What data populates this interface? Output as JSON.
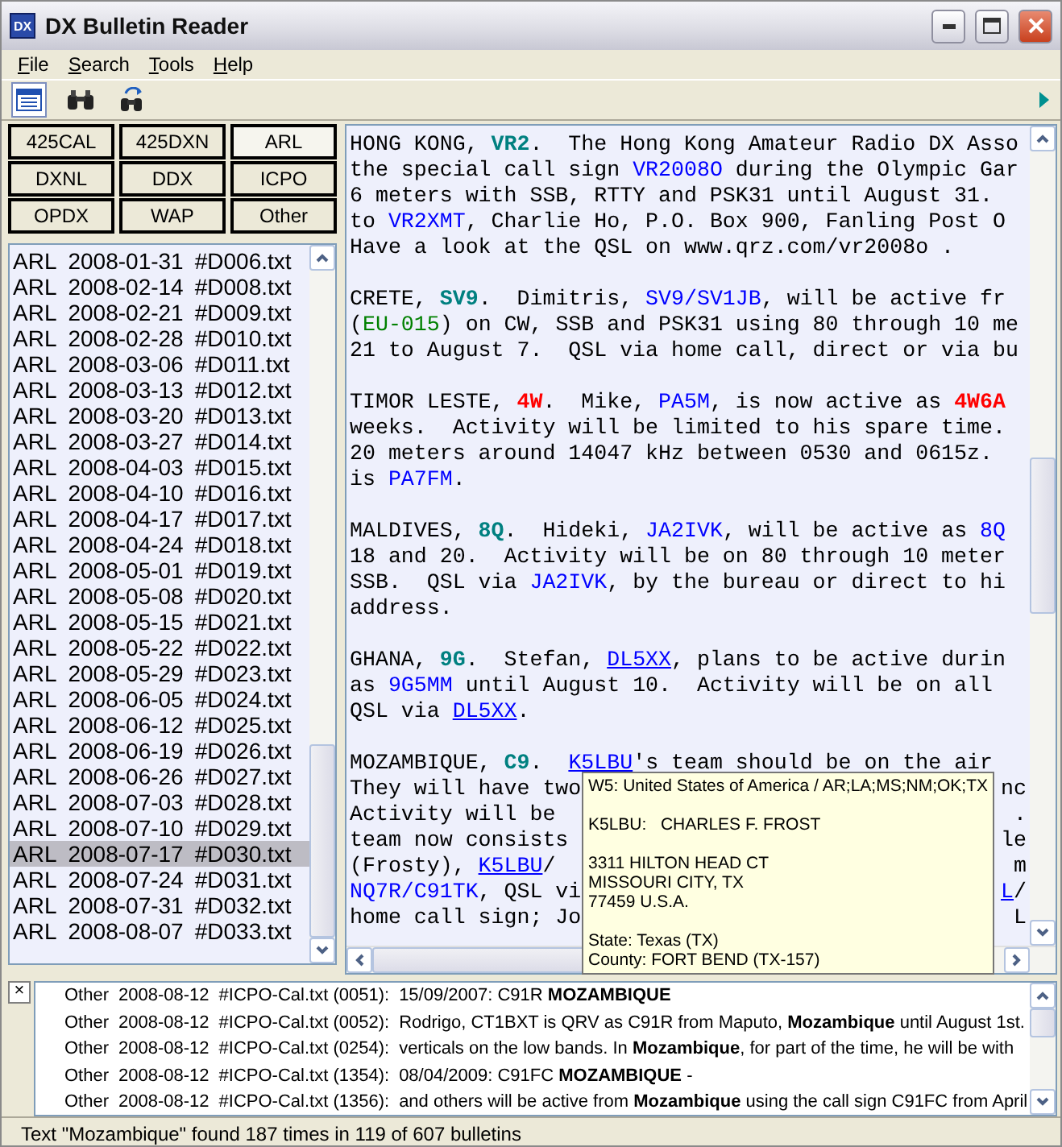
{
  "window": {
    "title": "DX Bulletin Reader",
    "app_icon": "DX"
  },
  "menu": [
    {
      "label": "File"
    },
    {
      "label": "Search"
    },
    {
      "label": "Tools"
    },
    {
      "label": "Help"
    }
  ],
  "toolbar": [
    {
      "kind": "list",
      "selected": true
    },
    {
      "kind": "search",
      "selected": false
    },
    {
      "kind": "search-again",
      "selected": false
    }
  ],
  "sources": [
    {
      "label": "425CAL",
      "selected": false
    },
    {
      "label": "425DXN",
      "selected": false
    },
    {
      "label": "ARL",
      "selected": true
    },
    {
      "label": "DXNL",
      "selected": false
    },
    {
      "label": "DDX",
      "selected": false
    },
    {
      "label": "ICPO",
      "selected": false
    },
    {
      "label": "OPDX",
      "selected": false
    },
    {
      "label": "WAP",
      "selected": false
    },
    {
      "label": "Other",
      "selected": false
    }
  ],
  "bulletins": [
    {
      "source": "ARL",
      "date": "2008-01-31",
      "file": "#D006.txt",
      "selected": false
    },
    {
      "source": "ARL",
      "date": "2008-02-14",
      "file": "#D008.txt",
      "selected": false
    },
    {
      "source": "ARL",
      "date": "2008-02-21",
      "file": "#D009.txt",
      "selected": false
    },
    {
      "source": "ARL",
      "date": "2008-02-28",
      "file": "#D010.txt",
      "selected": false
    },
    {
      "source": "ARL",
      "date": "2008-03-06",
      "file": "#D011.txt",
      "selected": false
    },
    {
      "source": "ARL",
      "date": "2008-03-13",
      "file": "#D012.txt",
      "selected": false
    },
    {
      "source": "ARL",
      "date": "2008-03-20",
      "file": "#D013.txt",
      "selected": false
    },
    {
      "source": "ARL",
      "date": "2008-03-27",
      "file": "#D014.txt",
      "selected": false
    },
    {
      "source": "ARL",
      "date": "2008-04-03",
      "file": "#D015.txt",
      "selected": false
    },
    {
      "source": "ARL",
      "date": "2008-04-10",
      "file": "#D016.txt",
      "selected": false
    },
    {
      "source": "ARL",
      "date": "2008-04-17",
      "file": "#D017.txt",
      "selected": false
    },
    {
      "source": "ARL",
      "date": "2008-04-24",
      "file": "#D018.txt",
      "selected": false
    },
    {
      "source": "ARL",
      "date": "2008-05-01",
      "file": "#D019.txt",
      "selected": false
    },
    {
      "source": "ARL",
      "date": "2008-05-08",
      "file": "#D020.txt",
      "selected": false
    },
    {
      "source": "ARL",
      "date": "2008-05-15",
      "file": "#D021.txt",
      "selected": false
    },
    {
      "source": "ARL",
      "date": "2008-05-22",
      "file": "#D022.txt",
      "selected": false
    },
    {
      "source": "ARL",
      "date": "2008-05-29",
      "file": "#D023.txt",
      "selected": false
    },
    {
      "source": "ARL",
      "date": "2008-06-05",
      "file": "#D024.txt",
      "selected": false
    },
    {
      "source": "ARL",
      "date": "2008-06-12",
      "file": "#D025.txt",
      "selected": false
    },
    {
      "source": "ARL",
      "date": "2008-06-19",
      "file": "#D026.txt",
      "selected": false
    },
    {
      "source": "ARL",
      "date": "2008-06-26",
      "file": "#D027.txt",
      "selected": false
    },
    {
      "source": "ARL",
      "date": "2008-07-03",
      "file": "#D028.txt",
      "selected": false
    },
    {
      "source": "ARL",
      "date": "2008-07-10",
      "file": "#D029.txt",
      "selected": false
    },
    {
      "source": "ARL",
      "date": "2008-07-17",
      "file": "#D030.txt",
      "selected": true
    },
    {
      "source": "ARL",
      "date": "2008-07-24",
      "file": "#D031.txt",
      "selected": false
    },
    {
      "source": "ARL",
      "date": "2008-07-31",
      "file": "#D032.txt",
      "selected": false
    },
    {
      "source": "ARL",
      "date": "2008-08-07",
      "file": "#D033.txt",
      "selected": false
    }
  ],
  "bulletin_text": [
    [
      {
        "segments": [
          {
            "kind": "text",
            "text": "HONG KONG, "
          },
          {
            "kind": "prefix",
            "text": "VR2"
          },
          {
            "kind": "text",
            "text": ".  The Hong Kong Amateur Radio DX Asso"
          }
        ]
      },
      {
        "segments": [
          {
            "kind": "text",
            "text": "the special call sign "
          },
          {
            "kind": "call",
            "text": "VR2008O"
          },
          {
            "kind": "text",
            "text": " during the Olympic Gar"
          }
        ]
      },
      {
        "segments": [
          {
            "kind": "text",
            "text": "6 meters with SSB, RTTY and PSK31 until August 31."
          }
        ]
      },
      {
        "segments": [
          {
            "kind": "text",
            "text": "to "
          },
          {
            "kind": "call",
            "text": "VR2XMT"
          },
          {
            "kind": "text",
            "text": ", Charlie Ho, P.O. Box 900, Fanling Post O"
          }
        ]
      },
      {
        "segments": [
          {
            "kind": "text",
            "text": "Have a look at the QSL on www.qrz.com/vr2008o ."
          }
        ]
      }
    ],
    [
      {
        "segments": [
          {
            "kind": "text",
            "text": "CRETE, "
          },
          {
            "kind": "prefix",
            "text": "SV9"
          },
          {
            "kind": "text",
            "text": ".  Dimitris, "
          },
          {
            "kind": "call",
            "text": "SV9/SV1JB"
          },
          {
            "kind": "text",
            "text": ", will be active fr"
          }
        ]
      },
      {
        "segments": [
          {
            "kind": "text",
            "text": "("
          },
          {
            "kind": "iota",
            "text": "EU-015"
          },
          {
            "kind": "text",
            "text": ") on CW, SSB and PSK31 using 80 through 10 me"
          }
        ]
      },
      {
        "segments": [
          {
            "kind": "text",
            "text": "21 to August 7.  QSL via home call, direct or via bu"
          }
        ]
      }
    ],
    [
      {
        "segments": [
          {
            "kind": "text",
            "text": "TIMOR LESTE, "
          },
          {
            "kind": "alert",
            "text": "4W"
          },
          {
            "kind": "text",
            "text": ".  Mike, "
          },
          {
            "kind": "call",
            "text": "PA5M"
          },
          {
            "kind": "text",
            "text": ", is now active as "
          },
          {
            "kind": "alert",
            "text": "4W6A"
          }
        ]
      },
      {
        "segments": [
          {
            "kind": "text",
            "text": "weeks.  Activity will be limited to his spare time."
          }
        ]
      },
      {
        "segments": [
          {
            "kind": "text",
            "text": "20 meters around 14047 kHz between 0530 and 0615z."
          }
        ]
      },
      {
        "segments": [
          {
            "kind": "text",
            "text": "is "
          },
          {
            "kind": "call",
            "text": "PA7FM"
          },
          {
            "kind": "text",
            "text": "."
          }
        ]
      }
    ],
    [
      {
        "segments": [
          {
            "kind": "text",
            "text": "MALDIVES, "
          },
          {
            "kind": "prefix",
            "text": "8Q"
          },
          {
            "kind": "text",
            "text": ".  Hideki, "
          },
          {
            "kind": "call",
            "text": "JA2IVK"
          },
          {
            "kind": "text",
            "text": ", will be active as "
          },
          {
            "kind": "call",
            "text": "8Q"
          }
        ]
      },
      {
        "segments": [
          {
            "kind": "text",
            "text": "18 and 20.  Activity will be on 80 through 10 meter"
          }
        ]
      },
      {
        "segments": [
          {
            "kind": "text",
            "text": "SSB.  QSL via "
          },
          {
            "kind": "call",
            "text": "JA2IVK"
          },
          {
            "kind": "text",
            "text": ", by the bureau or direct to hi"
          }
        ]
      },
      {
        "segments": [
          {
            "kind": "text",
            "text": "address."
          }
        ]
      }
    ],
    [
      {
        "segments": [
          {
            "kind": "text",
            "text": "GHANA, "
          },
          {
            "kind": "prefix",
            "text": "9G"
          },
          {
            "kind": "text",
            "text": ".  Stefan, "
          },
          {
            "kind": "link",
            "text": "DL5XX"
          },
          {
            "kind": "text",
            "text": ", plans to be active durin"
          }
        ]
      },
      {
        "segments": [
          {
            "kind": "text",
            "text": "as "
          },
          {
            "kind": "call",
            "text": "9G5MM"
          },
          {
            "kind": "text",
            "text": " until August 10.  Activity will be on all"
          }
        ]
      },
      {
        "segments": [
          {
            "kind": "text",
            "text": "QSL via "
          },
          {
            "kind": "link",
            "text": "DL5XX"
          },
          {
            "kind": "text",
            "text": "."
          }
        ]
      }
    ],
    [
      {
        "segments": [
          {
            "kind": "text",
            "text": "MOZAMBIQUE, "
          },
          {
            "kind": "prefix",
            "text": "C9"
          },
          {
            "kind": "text",
            "text": ".  "
          },
          {
            "kind": "link",
            "text": "K5LBU"
          },
          {
            "kind": "text",
            "text": "'s team should be on the air"
          }
        ]
      },
      {
        "segments": [
          {
            "kind": "text",
            "text": "They will have two"
          }
        ],
        "tail": [
          {
            "kind": "text",
            "text": "nc"
          }
        ]
      },
      {
        "segments": [
          {
            "kind": "text",
            "text": "Activity will be"
          }
        ],
        "tail": [
          {
            "kind": "text",
            "text": "."
          }
        ]
      },
      {
        "segments": [
          {
            "kind": "text",
            "text": "team now consists"
          }
        ],
        "tail": [
          {
            "kind": "text",
            "text": "le"
          }
        ]
      },
      {
        "segments": [
          {
            "kind": "text",
            "text": "(Frosty), "
          },
          {
            "kind": "link",
            "text": "K5LBU"
          },
          {
            "kind": "text",
            "text": "/"
          }
        ],
        "tail": [
          {
            "kind": "text",
            "text": "m"
          }
        ]
      },
      {
        "segments": [
          {
            "kind": "call",
            "text": "NQ7R/C91TK"
          },
          {
            "kind": "text",
            "text": ", QSL vi"
          }
        ],
        "tail": [
          {
            "kind": "link",
            "text": "L"
          },
          {
            "kind": "text",
            "text": "/"
          }
        ]
      },
      {
        "segments": [
          {
            "kind": "text",
            "text": "home call sign; Jo"
          }
        ],
        "tail": [
          {
            "kind": "text",
            "text": "L"
          }
        ]
      }
    ]
  ],
  "tooltip": {
    "groups": [
      [
        "W5: United States of America / AR;LA;MS;NM;OK;TX"
      ],
      [
        "K5LBU:   CHARLES F. FROST"
      ],
      [
        "3311 HILTON HEAD CT",
        "MISSOURI CITY, TX",
        "77459 U.S.A."
      ],
      [
        "State: Texas (TX)",
        "County: FORT BEND (TX-157)"
      ]
    ]
  },
  "results": [
    {
      "source": "Other",
      "date": "2008-08-12",
      "file": "#ICPO-Cal.txt (0051):",
      "snippet": "15/09/2007:  C91R  **MOZAMBIQUE**"
    },
    {
      "source": "Other",
      "date": "2008-08-12",
      "file": "#ICPO-Cal.txt (0052):",
      "snippet": "Rodrigo, CT1BXT is QRV as C91R from Maputo, **Mozambique** until August 1st."
    },
    {
      "source": "Other",
      "date": "2008-08-12",
      "file": "#ICPO-Cal.txt (0254):",
      "snippet": "verticals on the low bands. In **Mozambique**, for part of the time, he will be with"
    },
    {
      "source": "Other",
      "date": "2008-08-12",
      "file": "#ICPO-Cal.txt (1354):",
      "snippet": "08/04/2009:  C91FC  **MOZAMBIQUE** -"
    },
    {
      "source": "Other",
      "date": "2008-08-12",
      "file": "#ICPO-Cal.txt (1356):",
      "snippet": "and others will be active from **Mozambique** using the call sign C91FC from April"
    }
  ],
  "results_close": "×",
  "status_bar": "Text \"Mozambique\" found 187 times in 119 of 607 bulletins"
}
